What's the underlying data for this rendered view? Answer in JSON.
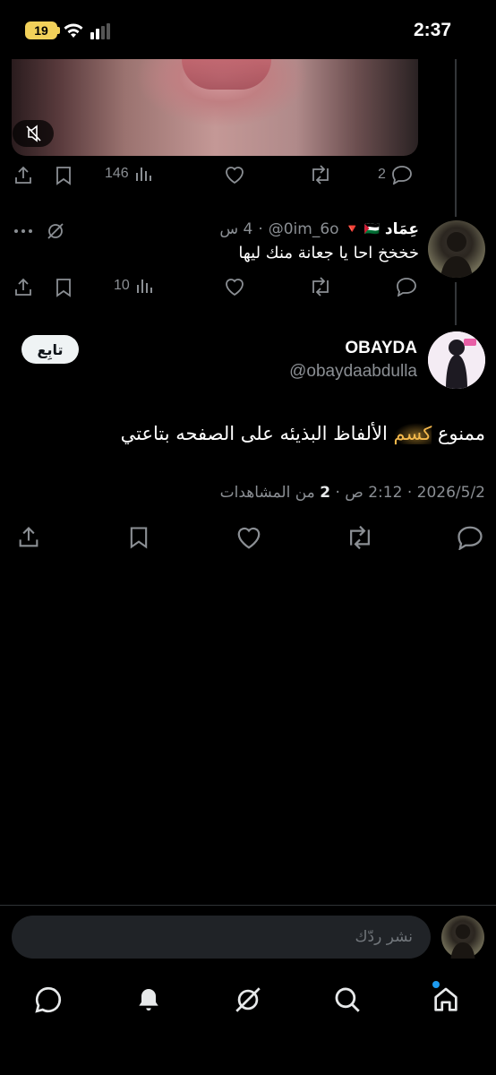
{
  "status_bar": {
    "time": "2:37",
    "battery": "19"
  },
  "prev_tweet": {
    "stats": {
      "replies": "2",
      "views": "146"
    }
  },
  "reply_tweet": {
    "name": "عِمَاد",
    "flags": "🇵🇸 🔻",
    "handle": "@0im_6o",
    "time": "4 س",
    "text": "خخخخ احا يا جعانة منك ليها",
    "stats": {
      "views": "10"
    }
  },
  "main_tweet": {
    "name": "OBAYDA",
    "handle": "@obaydaabdulla",
    "follow_label": "تابِع",
    "text_before": "ممنوع ",
    "text_highlight": "كسم",
    "text_after": " الألفاظ البذيئه على الصفحه بتاعتي",
    "date": "2026/5/2",
    "time": "2:12 ص",
    "views_count": "2",
    "views_label": "من المشاهدات"
  },
  "composer": {
    "placeholder": "نشر ردّك"
  },
  "colors": {
    "accent": "#1d9bf0",
    "highlight": "#f3b84c",
    "background": "#000000"
  }
}
